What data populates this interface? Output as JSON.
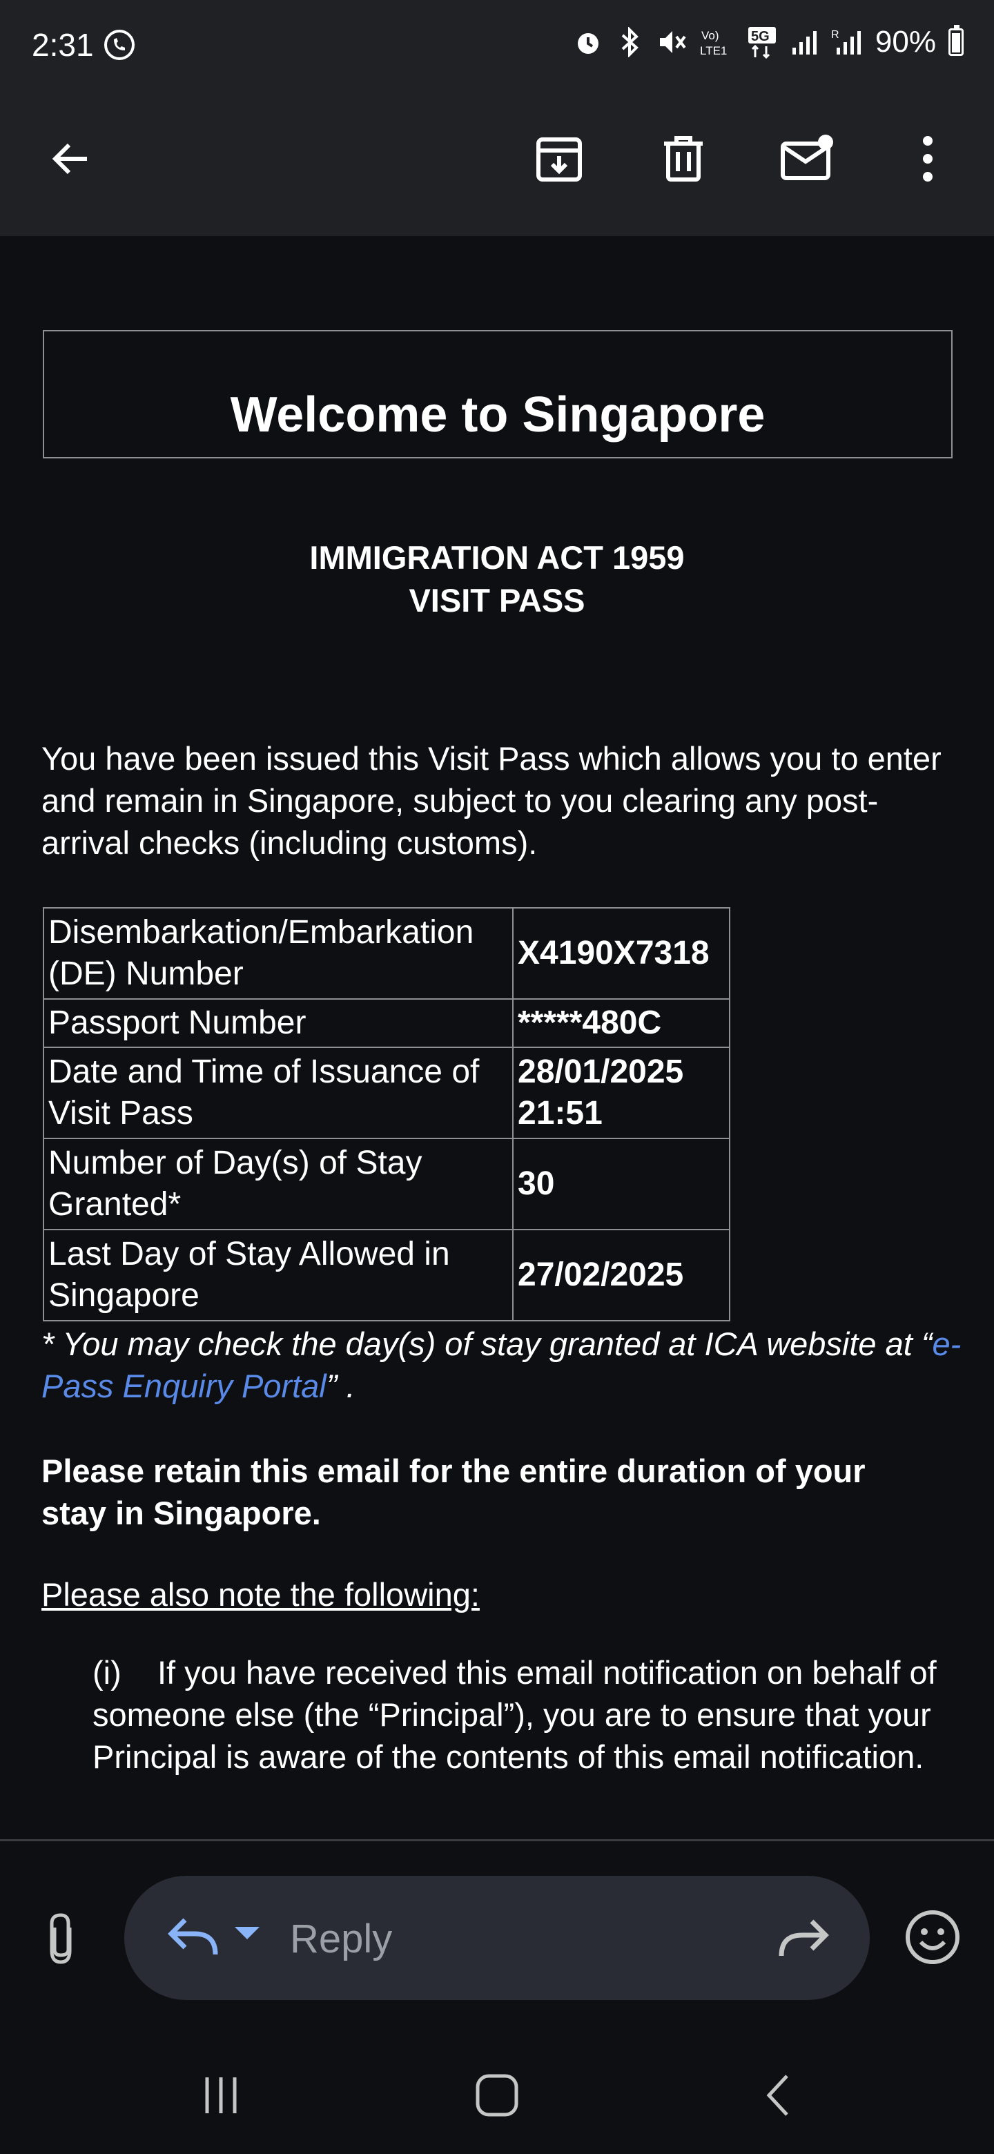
{
  "status_bar": {
    "time": "2:31",
    "battery": "90%"
  },
  "toolbar": {
    "icons": [
      "back-arrow-icon",
      "archive-icon",
      "delete-icon",
      "mark-unread-icon",
      "more-options-icon"
    ]
  },
  "email": {
    "welcome_title": "Welcome to Singapore",
    "act_line1": "IMMIGRATION ACT 1959",
    "act_line2": "VISIT PASS",
    "intro": "You have been issued this Visit Pass which allows you to enter and remain in Singapore, subject to you clearing any post-arrival checks (including customs).",
    "table": [
      {
        "label": "Disembarkation/Embarkation (DE) Number",
        "value": "X4190X7318"
      },
      {
        "label": "Passport Number",
        "value": "*****480C"
      },
      {
        "label": "Date and Time of Issuance of Visit Pass",
        "value": "28/01/2025 21:51"
      },
      {
        "label": "Number of Day(s) of Stay Granted*",
        "value": "30"
      },
      {
        "label": "Last Day of Stay Allowed in Singapore",
        "value": "27/02/2025"
      }
    ],
    "note_prefix": "* You may check the day(s) of stay granted at ICA website at “",
    "note_link": "e-Pass Enquiry Portal",
    "note_suffix": "” .",
    "retain": "Please retain this email for the entire duration of your stay in Singapore.",
    "note_follow": "Please also note the following:",
    "item_i_marker": "(i)",
    "item_i_text": "If you have received this email notification on behalf of someone else (the “Principal”), you are to ensure that your Principal is aware of the contents of this email notification."
  },
  "reply_bar": {
    "reply_label": "Reply"
  },
  "colors": {
    "background": "#0e0f13",
    "bar": "#202125",
    "link": "#5a8ae8",
    "reply_pill": "#2a2c35"
  }
}
